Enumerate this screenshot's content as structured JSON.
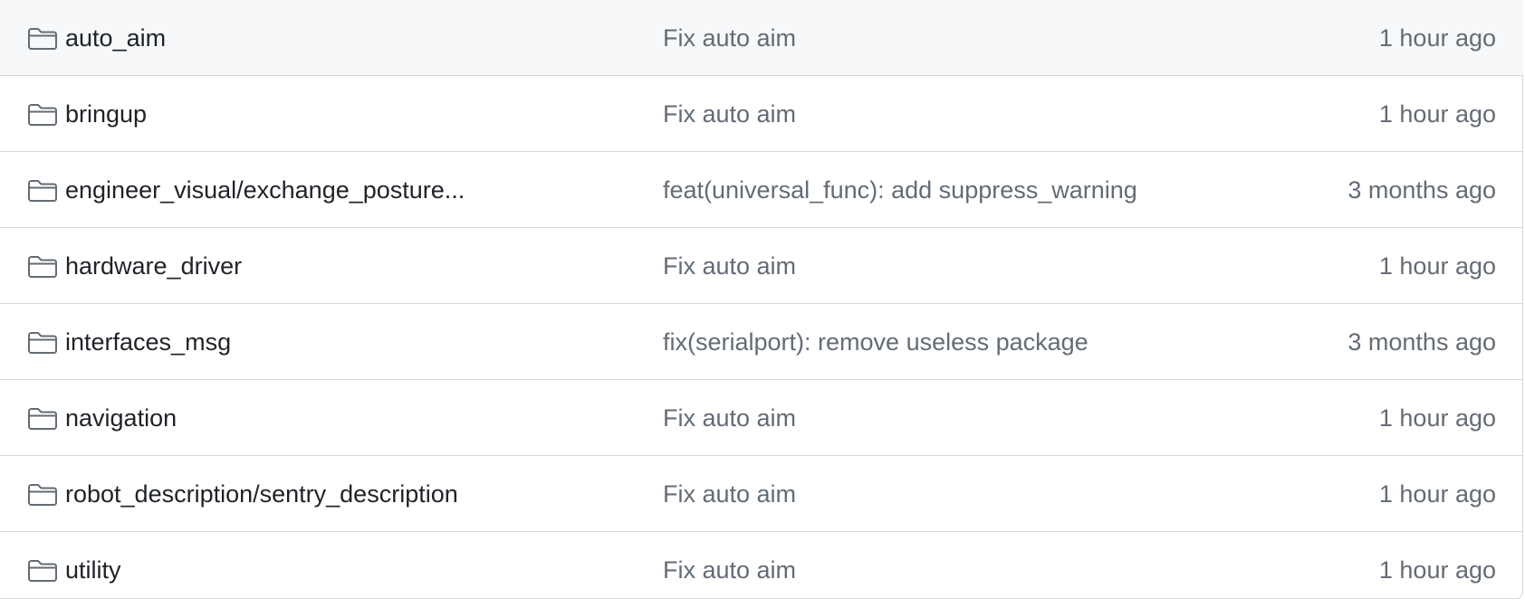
{
  "files": [
    {
      "icon": "folder-icon",
      "name": "auto_aim",
      "commit": "Fix auto aim",
      "age": "1 hour ago"
    },
    {
      "icon": "folder-icon",
      "name": "bringup",
      "commit": "Fix auto aim",
      "age": "1 hour ago"
    },
    {
      "icon": "folder-icon",
      "name": "engineer_visual/exchange_posture...",
      "commit": "feat(universal_func): add suppress_warning",
      "age": "3 months ago"
    },
    {
      "icon": "folder-icon",
      "name": "hardware_driver",
      "commit": "Fix auto aim",
      "age": "1 hour ago"
    },
    {
      "icon": "folder-icon",
      "name": "interfaces_msg",
      "commit": "fix(serialport): remove useless package",
      "age": "3 months ago"
    },
    {
      "icon": "folder-icon",
      "name": "navigation",
      "commit": "Fix auto aim",
      "age": "1 hour ago"
    },
    {
      "icon": "folder-icon",
      "name": "robot_description/sentry_description",
      "commit": "Fix auto aim",
      "age": "1 hour ago"
    },
    {
      "icon": "folder-icon",
      "name": "utility",
      "commit": "Fix auto aim",
      "age": "1 hour ago"
    }
  ],
  "colors": {
    "name_text": "#1f2328",
    "muted_text": "#636c76",
    "border": "#d0d7de",
    "link_hover": "#0969da"
  }
}
